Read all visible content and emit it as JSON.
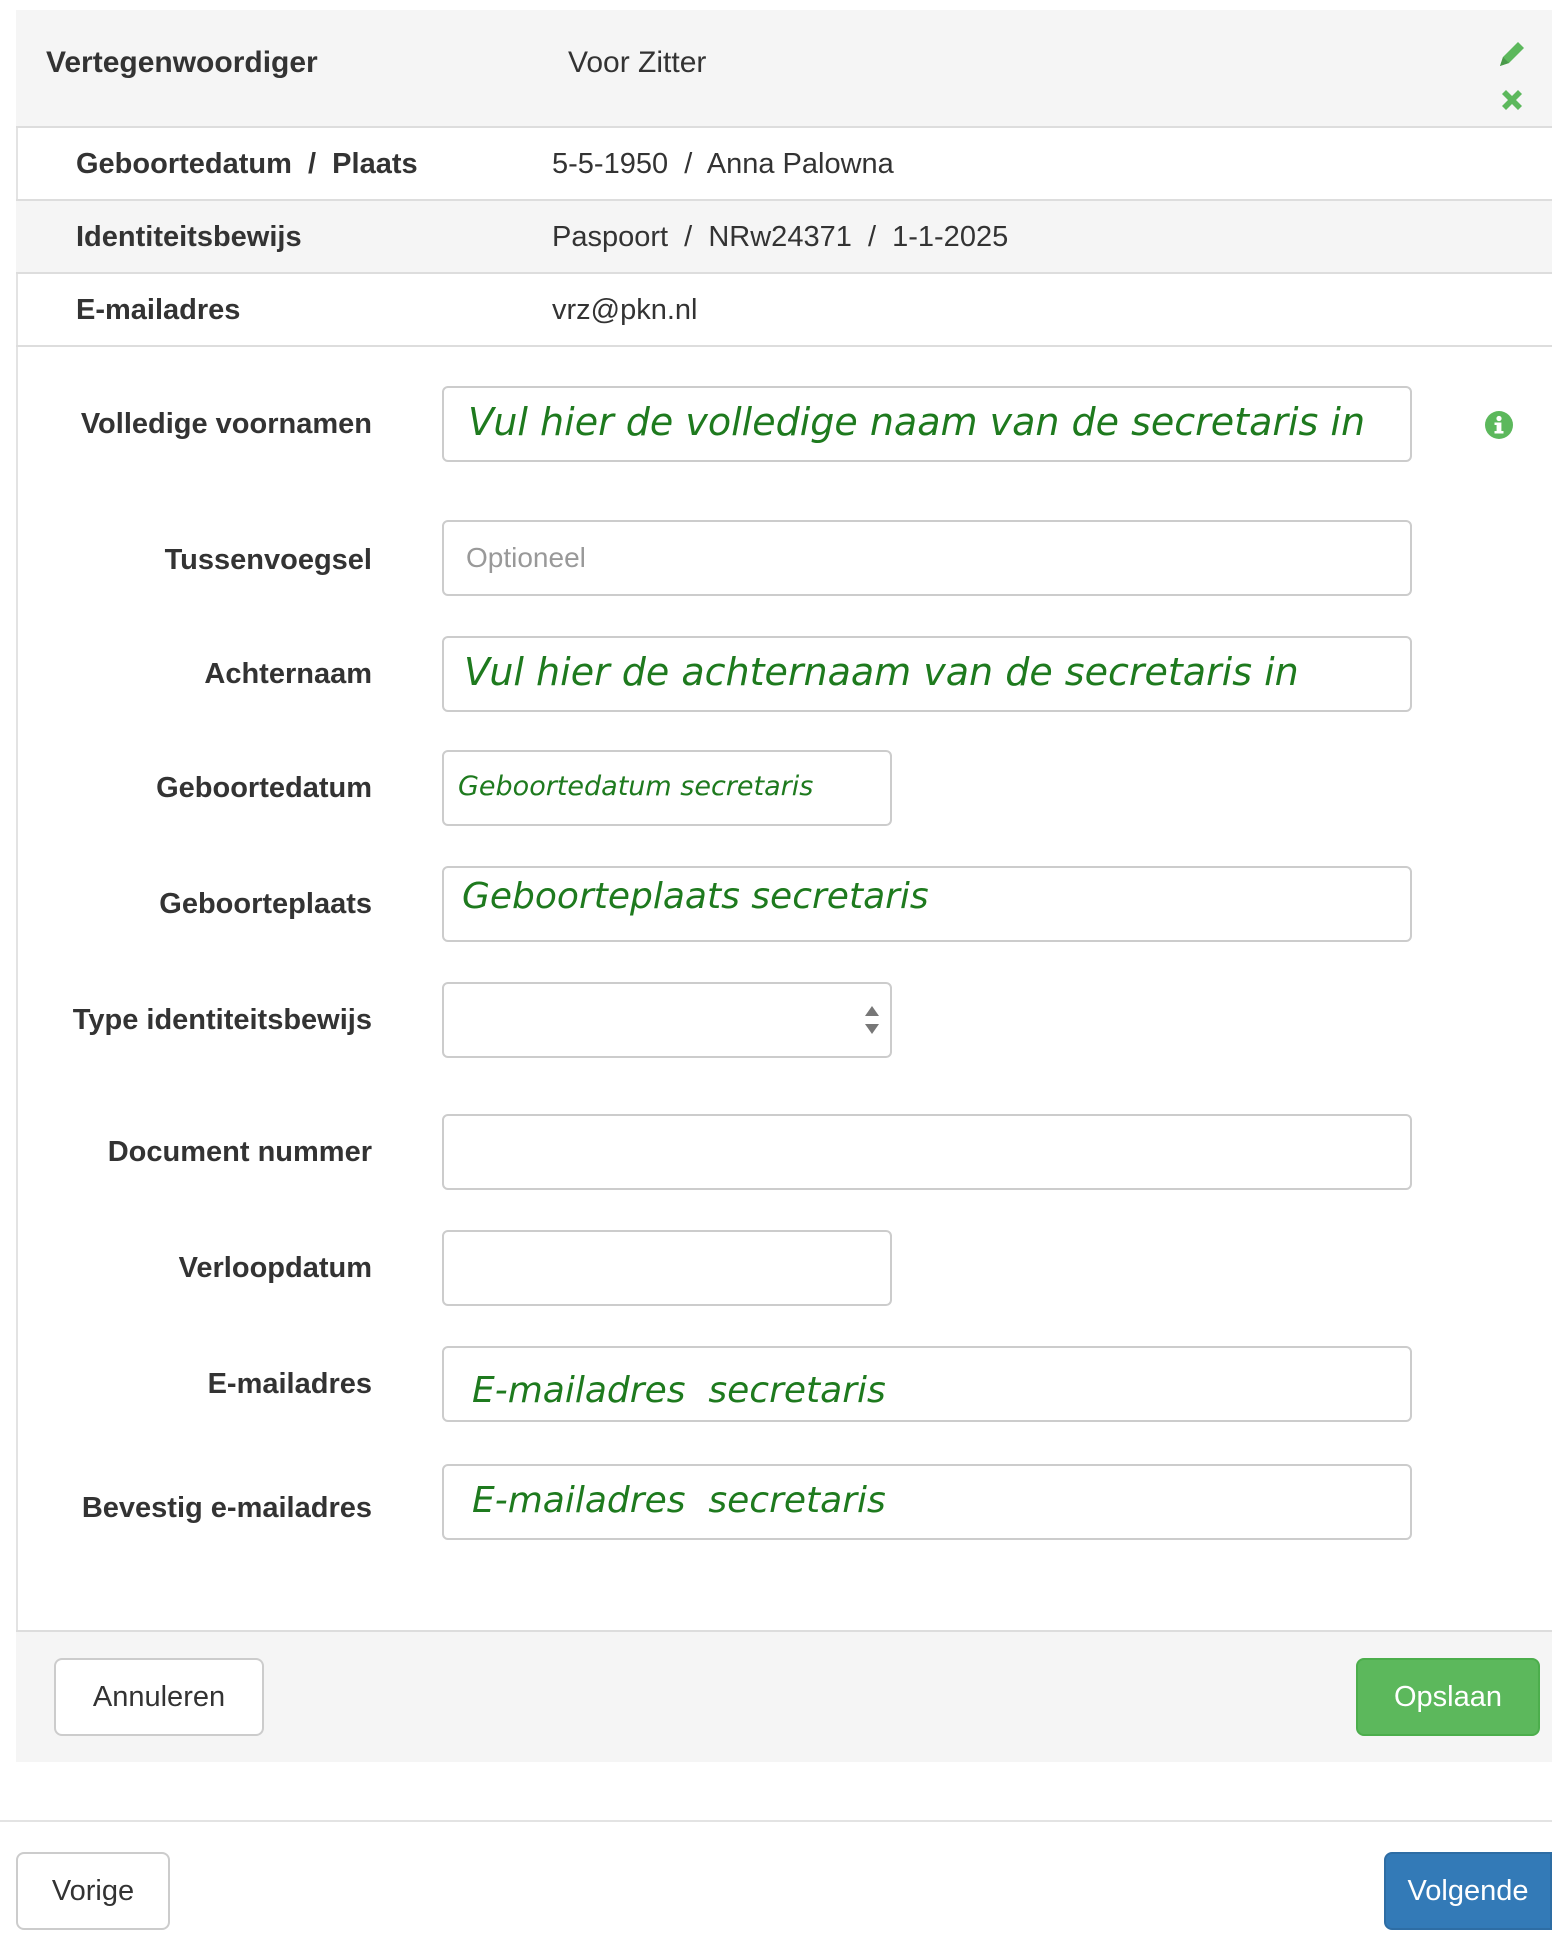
{
  "representative": {
    "label": "Vertegenwoordiger",
    "value": "Voor Zitter",
    "edit_icon": "pencil-icon",
    "remove_icon": "times-icon"
  },
  "details": [
    {
      "key": "Geboortedatum  /  Plaats",
      "value": "5-5-1950  /  Anna Palowna"
    },
    {
      "key": "Identiteitsbewijs",
      "value": "Paspoort  /  NRw24371  /  1-1-2025"
    },
    {
      "key": "E-mailadres",
      "value": "vrz@pkn.nl"
    }
  ],
  "form": {
    "first_names": {
      "label": "Volledige voornamen",
      "value": "",
      "hint": "Vul hier de volledige naam van de secretaris in"
    },
    "infix": {
      "label": "Tussenvoegsel",
      "placeholder": "Optioneel",
      "value": ""
    },
    "last_name": {
      "label": "Achternaam",
      "value": "",
      "hint": "Vul hier de achternaam van de secretaris in"
    },
    "birth_date": {
      "label": "Geboortedatum",
      "value": "",
      "hint": "Geboortedatum secretaris"
    },
    "birth_place": {
      "label": "Geboorteplaats",
      "value": "",
      "hint": "Geboorteplaats secretaris"
    },
    "id_type": {
      "label": "Type identiteitsbewijs",
      "selected": ""
    },
    "document_number": {
      "label": "Document nummer",
      "value": ""
    },
    "expiry_date": {
      "label": "Verloopdatum",
      "value": ""
    },
    "email": {
      "label": "E-mailadres",
      "value": "",
      "hint": "E-mailadres  secretaris"
    },
    "email_confirm": {
      "label": "Bevestig e-mailadres",
      "value": "",
      "hint": "E-mailadres  secretaris"
    },
    "info_icon": "info-circle-icon"
  },
  "panel_actions": {
    "cancel": "Annuleren",
    "save": "Opslaan"
  },
  "wizard_nav": {
    "previous": "Vorige",
    "next": "Volgende"
  },
  "colors": {
    "hint_text": "#1e7a1e",
    "save": "#5cb85c",
    "next": "#337ab7",
    "icon_green": "#5cb85c"
  }
}
